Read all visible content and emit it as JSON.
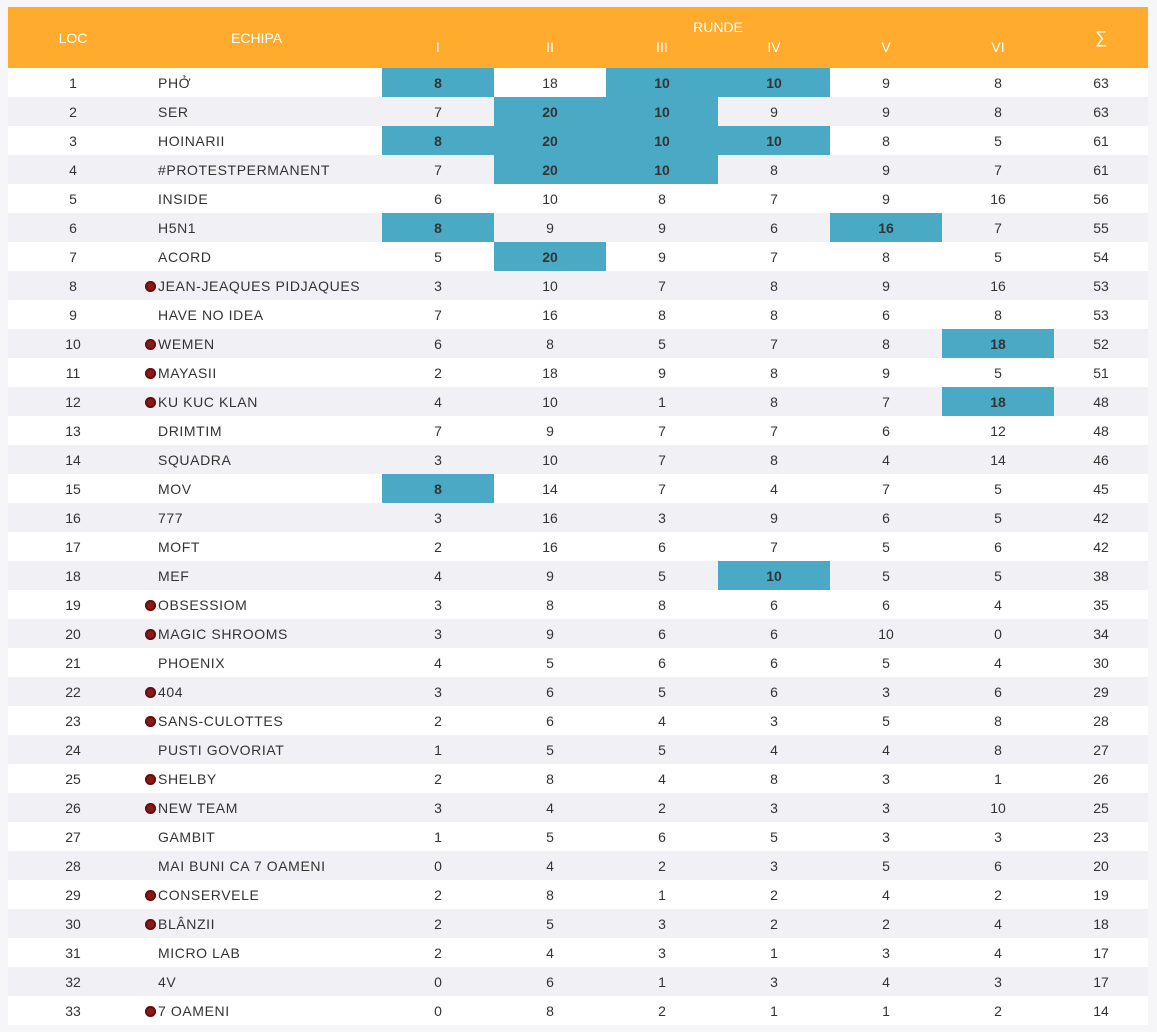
{
  "table": {
    "headers": {
      "loc": "LOC",
      "team": "ECHIPA",
      "rounds_group": "RUNDE",
      "rounds": [
        "I",
        "II",
        "III",
        "IV",
        "V",
        "VI"
      ],
      "total": "∑"
    },
    "highlight_color": "#4aaac6",
    "header_color": "#ffab2e",
    "marker_icon": "dark-red-dot",
    "rows": [
      {
        "loc": "1",
        "team": "PHỞ",
        "marked": false,
        "scores": [
          "8",
          "18",
          "10",
          "10",
          "9",
          "8"
        ],
        "highlight": [
          true,
          false,
          true,
          true,
          false,
          false
        ],
        "total": "63"
      },
      {
        "loc": "2",
        "team": "SER",
        "marked": false,
        "scores": [
          "7",
          "20",
          "10",
          "9",
          "9",
          "8"
        ],
        "highlight": [
          false,
          true,
          true,
          false,
          false,
          false
        ],
        "total": "63"
      },
      {
        "loc": "3",
        "team": "HOINARII",
        "marked": false,
        "scores": [
          "8",
          "20",
          "10",
          "10",
          "8",
          "5"
        ],
        "highlight": [
          true,
          true,
          true,
          true,
          false,
          false
        ],
        "total": "61"
      },
      {
        "loc": "4",
        "team": "#PROTESTPERMANENT",
        "marked": false,
        "scores": [
          "7",
          "20",
          "10",
          "8",
          "9",
          "7"
        ],
        "highlight": [
          false,
          true,
          true,
          false,
          false,
          false
        ],
        "total": "61"
      },
      {
        "loc": "5",
        "team": "INSIDE",
        "marked": false,
        "scores": [
          "6",
          "10",
          "8",
          "7",
          "9",
          "16"
        ],
        "highlight": [
          false,
          false,
          false,
          false,
          false,
          false
        ],
        "total": "56"
      },
      {
        "loc": "6",
        "team": "H5N1",
        "marked": false,
        "scores": [
          "8",
          "9",
          "9",
          "6",
          "16",
          "7"
        ],
        "highlight": [
          true,
          false,
          false,
          false,
          true,
          false
        ],
        "total": "55"
      },
      {
        "loc": "7",
        "team": "ACORD",
        "marked": false,
        "scores": [
          "5",
          "20",
          "9",
          "7",
          "8",
          "5"
        ],
        "highlight": [
          false,
          true,
          false,
          false,
          false,
          false
        ],
        "total": "54"
      },
      {
        "loc": "8",
        "team": "JEAN-JEAQUES PIDJAQUES",
        "marked": true,
        "scores": [
          "3",
          "10",
          "7",
          "8",
          "9",
          "16"
        ],
        "highlight": [
          false,
          false,
          false,
          false,
          false,
          false
        ],
        "total": "53"
      },
      {
        "loc": "9",
        "team": "HAVE NO IDEA",
        "marked": false,
        "scores": [
          "7",
          "16",
          "8",
          "8",
          "6",
          "8"
        ],
        "highlight": [
          false,
          false,
          false,
          false,
          false,
          false
        ],
        "total": "53"
      },
      {
        "loc": "10",
        "team": "WEMEN",
        "marked": true,
        "scores": [
          "6",
          "8",
          "5",
          "7",
          "8",
          "18"
        ],
        "highlight": [
          false,
          false,
          false,
          false,
          false,
          true
        ],
        "total": "52"
      },
      {
        "loc": "11",
        "team": "MAYASII",
        "marked": true,
        "scores": [
          "2",
          "18",
          "9",
          "8",
          "9",
          "5"
        ],
        "highlight": [
          false,
          false,
          false,
          false,
          false,
          false
        ],
        "total": "51"
      },
      {
        "loc": "12",
        "team": "KU KUC KLAN",
        "marked": true,
        "scores": [
          "4",
          "10",
          "1",
          "8",
          "7",
          "18"
        ],
        "highlight": [
          false,
          false,
          false,
          false,
          false,
          true
        ],
        "total": "48"
      },
      {
        "loc": "13",
        "team": "DRIMTIM",
        "marked": false,
        "scores": [
          "7",
          "9",
          "7",
          "7",
          "6",
          "12"
        ],
        "highlight": [
          false,
          false,
          false,
          false,
          false,
          false
        ],
        "total": "48"
      },
      {
        "loc": "14",
        "team": "SQUADRA",
        "marked": false,
        "scores": [
          "3",
          "10",
          "7",
          "8",
          "4",
          "14"
        ],
        "highlight": [
          false,
          false,
          false,
          false,
          false,
          false
        ],
        "total": "46"
      },
      {
        "loc": "15",
        "team": "MOV",
        "marked": false,
        "scores": [
          "8",
          "14",
          "7",
          "4",
          "7",
          "5"
        ],
        "highlight": [
          true,
          false,
          false,
          false,
          false,
          false
        ],
        "total": "45"
      },
      {
        "loc": "16",
        "team": "777",
        "marked": false,
        "scores": [
          "3",
          "16",
          "3",
          "9",
          "6",
          "5"
        ],
        "highlight": [
          false,
          false,
          false,
          false,
          false,
          false
        ],
        "total": "42"
      },
      {
        "loc": "17",
        "team": "MOFT",
        "marked": false,
        "scores": [
          "2",
          "16",
          "6",
          "7",
          "5",
          "6"
        ],
        "highlight": [
          false,
          false,
          false,
          false,
          false,
          false
        ],
        "total": "42"
      },
      {
        "loc": "18",
        "team": "MEF",
        "marked": false,
        "scores": [
          "4",
          "9",
          "5",
          "10",
          "5",
          "5"
        ],
        "highlight": [
          false,
          false,
          false,
          true,
          false,
          false
        ],
        "total": "38"
      },
      {
        "loc": "19",
        "team": "OBSESSIOM",
        "marked": true,
        "scores": [
          "3",
          "8",
          "8",
          "6",
          "6",
          "4"
        ],
        "highlight": [
          false,
          false,
          false,
          false,
          false,
          false
        ],
        "total": "35"
      },
      {
        "loc": "20",
        "team": "MAGIC SHROOMS",
        "marked": true,
        "scores": [
          "3",
          "9",
          "6",
          "6",
          "10",
          "0"
        ],
        "highlight": [
          false,
          false,
          false,
          false,
          false,
          false
        ],
        "total": "34"
      },
      {
        "loc": "21",
        "team": "PHOENIX",
        "marked": false,
        "scores": [
          "4",
          "5",
          "6",
          "6",
          "5",
          "4"
        ],
        "highlight": [
          false,
          false,
          false,
          false,
          false,
          false
        ],
        "total": "30"
      },
      {
        "loc": "22",
        "team": "404",
        "marked": true,
        "scores": [
          "3",
          "6",
          "5",
          "6",
          "3",
          "6"
        ],
        "highlight": [
          false,
          false,
          false,
          false,
          false,
          false
        ],
        "total": "29"
      },
      {
        "loc": "23",
        "team": "SANS-CULOTTES",
        "marked": true,
        "scores": [
          "2",
          "6",
          "4",
          "3",
          "5",
          "8"
        ],
        "highlight": [
          false,
          false,
          false,
          false,
          false,
          false
        ],
        "total": "28"
      },
      {
        "loc": "24",
        "team": "PUSTI GOVORIAT",
        "marked": false,
        "scores": [
          "1",
          "5",
          "5",
          "4",
          "4",
          "8"
        ],
        "highlight": [
          false,
          false,
          false,
          false,
          false,
          false
        ],
        "total": "27"
      },
      {
        "loc": "25",
        "team": "SHELBY",
        "marked": true,
        "scores": [
          "2",
          "8",
          "4",
          "8",
          "3",
          "1"
        ],
        "highlight": [
          false,
          false,
          false,
          false,
          false,
          false
        ],
        "total": "26"
      },
      {
        "loc": "26",
        "team": "NEW TEAM",
        "marked": true,
        "scores": [
          "3",
          "4",
          "2",
          "3",
          "3",
          "10"
        ],
        "highlight": [
          false,
          false,
          false,
          false,
          false,
          false
        ],
        "total": "25"
      },
      {
        "loc": "27",
        "team": "GAMBIT",
        "marked": false,
        "scores": [
          "1",
          "5",
          "6",
          "5",
          "3",
          "3"
        ],
        "highlight": [
          false,
          false,
          false,
          false,
          false,
          false
        ],
        "total": "23"
      },
      {
        "loc": "28",
        "team": "MAI BUNI CA 7 OAMENI",
        "marked": false,
        "scores": [
          "0",
          "4",
          "2",
          "3",
          "5",
          "6"
        ],
        "highlight": [
          false,
          false,
          false,
          false,
          false,
          false
        ],
        "total": "20"
      },
      {
        "loc": "29",
        "team": "CONSERVELE",
        "marked": true,
        "scores": [
          "2",
          "8",
          "1",
          "2",
          "4",
          "2"
        ],
        "highlight": [
          false,
          false,
          false,
          false,
          false,
          false
        ],
        "total": "19"
      },
      {
        "loc": "30",
        "team": "BLÂNZII",
        "marked": true,
        "scores": [
          "2",
          "5",
          "3",
          "2",
          "2",
          "4"
        ],
        "highlight": [
          false,
          false,
          false,
          false,
          false,
          false
        ],
        "total": "18"
      },
      {
        "loc": "31",
        "team": "MICRO LAB",
        "marked": false,
        "scores": [
          "2",
          "4",
          "3",
          "1",
          "3",
          "4"
        ],
        "highlight": [
          false,
          false,
          false,
          false,
          false,
          false
        ],
        "total": "17"
      },
      {
        "loc": "32",
        "team": "4V",
        "marked": false,
        "scores": [
          "0",
          "6",
          "1",
          "3",
          "4",
          "3"
        ],
        "highlight": [
          false,
          false,
          false,
          false,
          false,
          false
        ],
        "total": "17"
      },
      {
        "loc": "33",
        "team": "7 OAMENI",
        "marked": true,
        "scores": [
          "0",
          "8",
          "2",
          "1",
          "1",
          "2"
        ],
        "highlight": [
          false,
          false,
          false,
          false,
          false,
          false
        ],
        "total": "14"
      }
    ]
  }
}
